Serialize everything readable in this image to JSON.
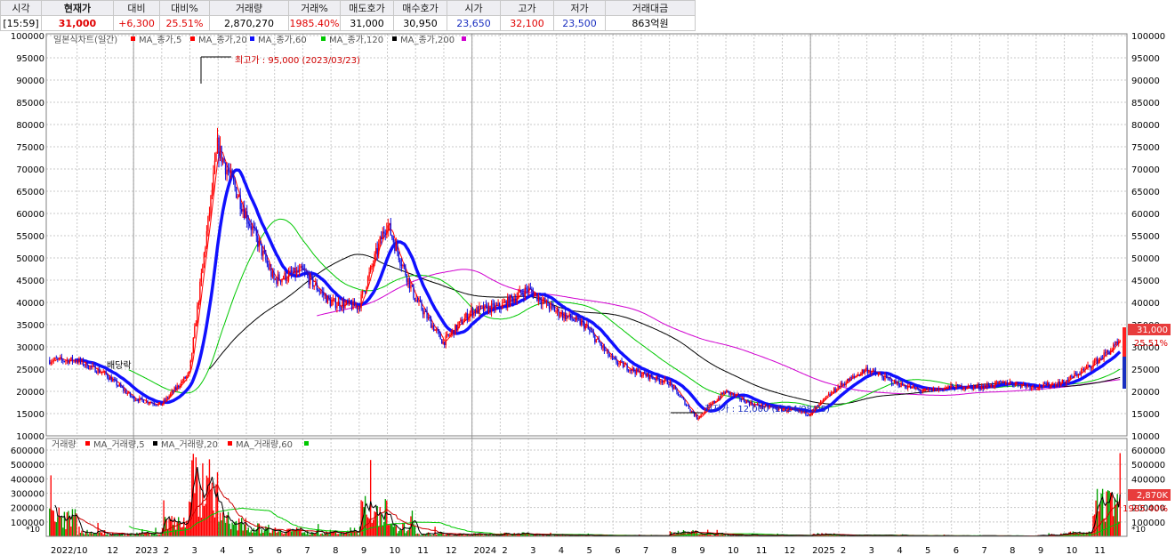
{
  "quote_bar": {
    "headers": [
      "시각",
      "현재가",
      "대비",
      "대비%",
      "거래량",
      "거래%",
      "매도호가",
      "매수호가",
      "시가",
      "고가",
      "저가",
      "거래대금"
    ],
    "values": [
      "[15:59]",
      "31,000",
      "+6,300",
      "25.51%",
      "2,870,270",
      "1985.40%",
      "31,000",
      "30,950",
      "23,650",
      "32,100",
      "23,500",
      "863억원"
    ]
  },
  "price_panel": {
    "legend": [
      "일본식차트(일간)",
      "MA_종가,5",
      "MA_종가,20",
      "MA_종가,60",
      "MA_종가,120",
      "MA_종가,200"
    ],
    "y_ticks": [
      "100000",
      "95000",
      "90000",
      "85000",
      "80000",
      "75000",
      "70000",
      "65000",
      "60000",
      "55000",
      "50000",
      "45000",
      "40000",
      "35000",
      "30000",
      "25000",
      "20000",
      "15000",
      "10000"
    ],
    "high_annotation": "최고가 : 95,000 (2023/03/23)",
    "low_annotation": "최저가 : 12,000 (2024/08/05)",
    "dividend_label": "배당락",
    "last_price_badge": "31,000",
    "change_badge": "25.51%"
  },
  "volume_panel": {
    "legend": [
      "거래량",
      "MA_거래량,5",
      "MA_거래량,20",
      "MA_거래량,60"
    ],
    "y_ticks": [
      "600000",
      "500000",
      "400000",
      "300000",
      "200000",
      "100000"
    ],
    "scale_label": "*10",
    "last_volume_badge": "2,870K",
    "volume_ratio_badge": "1985.40%"
  },
  "x_axis": {
    "labels": [
      "2022/10",
      "12",
      "2023",
      "2",
      "3",
      "4",
      "5",
      "6",
      "7",
      "8",
      "9",
      "10",
      "11",
      "12",
      "2024",
      "2",
      "3",
      "4",
      "5",
      "6",
      "7",
      "8",
      "9",
      "10",
      "11",
      "12",
      "2025",
      "2",
      "3",
      "4",
      "5",
      "6",
      "7",
      "8",
      "9",
      "10",
      "11"
    ]
  },
  "colors": {
    "up": "#ff0000",
    "down": "#1010e0",
    "ma5": "#ff0000",
    "ma20": "#00c800",
    "ma60": "#1010ff",
    "ma120": "#000000",
    "ma200": "#d000d0",
    "badge_red": "#e83c3c",
    "badge_blue": "#1a2fc0"
  },
  "chart_data": {
    "type": "candlestick",
    "title": "일본식차트(일간)",
    "price_range": [
      10000,
      100000
    ],
    "volume_range": [
      0,
      600000
    ],
    "volume_unit": "*10",
    "x": [
      "2022-10",
      "2022-11",
      "2022-12",
      "2023-01",
      "2023-02",
      "2023-03",
      "2023-04",
      "2023-05",
      "2023-06",
      "2023-07",
      "2023-08",
      "2023-09",
      "2023-10",
      "2023-11",
      "2023-12",
      "2024-01",
      "2024-02",
      "2024-03",
      "2024-04",
      "2024-05",
      "2024-06",
      "2024-07",
      "2024-08",
      "2024-09",
      "2024-10",
      "2024-11",
      "2024-12",
      "2025-01",
      "2025-02",
      "2025-03",
      "2025-04",
      "2025-05",
      "2025-06",
      "2025-07",
      "2025-08",
      "2025-09",
      "2025-10",
      "2025-11"
    ],
    "close": [
      27000,
      24000,
      18500,
      17000,
      24000,
      75000,
      60000,
      45000,
      47000,
      40000,
      39000,
      58000,
      41000,
      31000,
      38000,
      39000,
      43000,
      38000,
      35000,
      27000,
      24000,
      22000,
      14000,
      20000,
      17000,
      16000,
      15000,
      21000,
      25000,
      22000,
      20000,
      21000,
      21000,
      22000,
      21000,
      22000,
      26000,
      31000
    ],
    "volume": [
      180000,
      40000,
      20000,
      25000,
      150000,
      520000,
      150000,
      80000,
      60000,
      40000,
      35000,
      250000,
      80000,
      30000,
      20000,
      20000,
      25000,
      15000,
      10000,
      8000,
      6000,
      5000,
      40000,
      20000,
      10000,
      8000,
      8000,
      20000,
      10000,
      8000,
      6000,
      5000,
      5000,
      5000,
      4000,
      10000,
      30000,
      287027
    ],
    "annotations": [
      {
        "label": "최고가",
        "date": "2023-03-23",
        "value": 95000
      },
      {
        "label": "최저가",
        "date": "2024-08-05",
        "value": 12000
      }
    ],
    "last": {
      "price": 31000,
      "change_pct": 25.51,
      "volume": "2,870K",
      "volume_ratio": "1985.40%"
    }
  }
}
